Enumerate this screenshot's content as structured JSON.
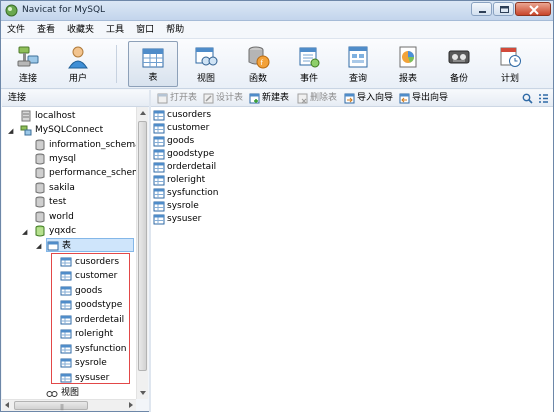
{
  "window": {
    "title": "Navicat for MySQL"
  },
  "menu": [
    "文件",
    "查看",
    "收藏夹",
    "工具",
    "窗口",
    "帮助"
  ],
  "toolbar": {
    "connect": "连接",
    "user": "用户",
    "table": "表",
    "view": "视图",
    "function": "函数",
    "event": "事件",
    "query": "查询",
    "report": "报表",
    "backup": "备份",
    "schedule": "计划"
  },
  "left_pane": {
    "header": "连接"
  },
  "tree": {
    "localhost": "localhost",
    "connection": "MySQLConnect",
    "databases": [
      "information_schema",
      "mysql",
      "performance_schema",
      "sakila",
      "test",
      "world"
    ],
    "open_db": "yqxdc",
    "tables_node": "表",
    "tables": [
      "cusorders",
      "customer",
      "goods",
      "goodstype",
      "orderdetail",
      "roleright",
      "sysfunction",
      "sysrole",
      "sysuser"
    ],
    "views_node": "视图"
  },
  "object_toolbar": {
    "open_table": "打开表",
    "design_table": "设计表",
    "new_table": "新建表",
    "delete_table": "删除表",
    "import_wizard": "导入向导",
    "export_wizard": "导出向导"
  },
  "object_list": [
    "cusorders",
    "customer",
    "goods",
    "goodstype",
    "orderdetail",
    "roleright",
    "sysfunction",
    "sysrole",
    "sysuser"
  ],
  "colors": {
    "highlight_border": "#e24848",
    "selection": "#cfe5fb"
  }
}
